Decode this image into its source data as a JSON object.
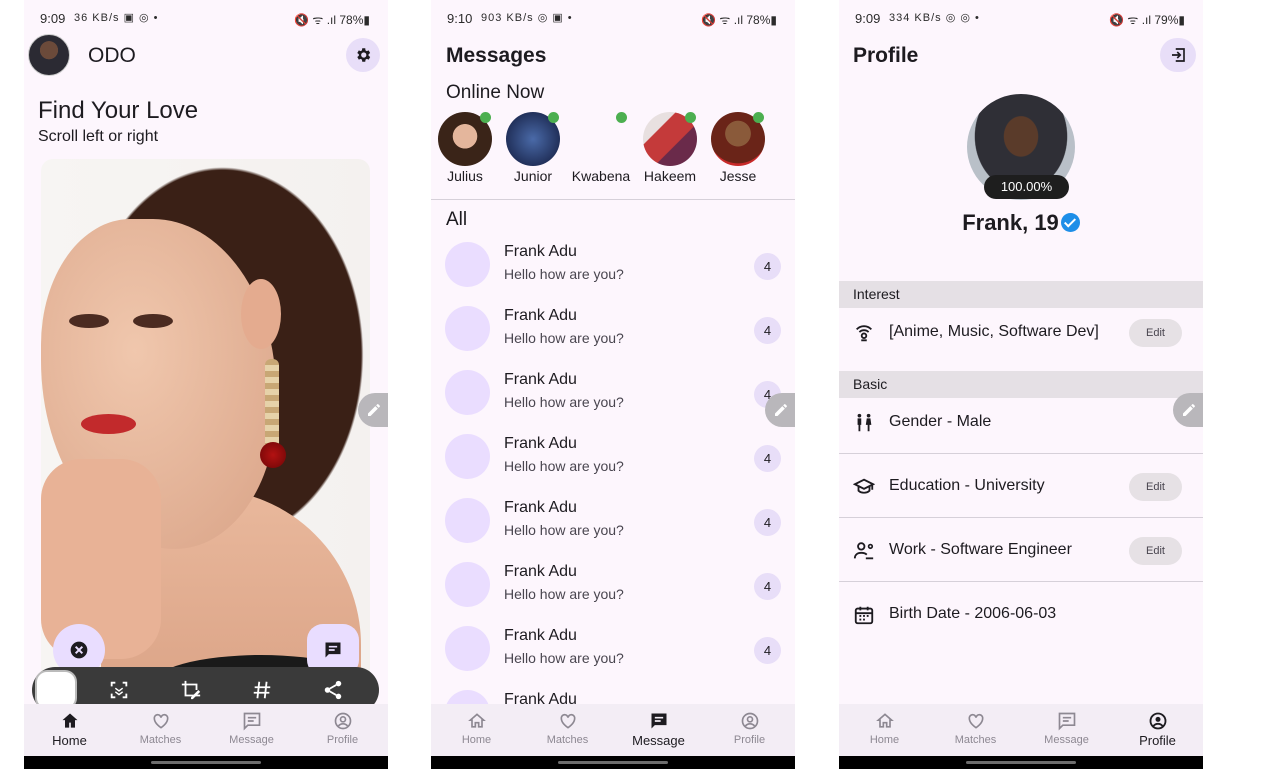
{
  "status_bars": [
    {
      "time": "9:09",
      "extra": "36 KB/s ▣ ◎ •",
      "right": "🔇 ᯤ .ıl 78%▮"
    },
    {
      "time": "9:10",
      "extra": "903 KB/s ◎ ▣ •",
      "right": "🔇 ᯤ .ıl 78%▮"
    },
    {
      "time": "9:09",
      "extra": "334 KB/s ◎ ◎ •",
      "right": "🔇 ᯤ .ıl 79%▮"
    }
  ],
  "home": {
    "app_title": "ODO",
    "heading": "Find Your Love",
    "subheading": "Scroll left or right"
  },
  "messages": {
    "title": "Messages",
    "online_label": "Online Now",
    "all_label": "All",
    "online": [
      {
        "name": "Julius",
        "color": "#c98f78"
      },
      {
        "name": "Junior",
        "color": "#223a6e"
      },
      {
        "name": "Kwabena",
        "color": "#fdf6fd"
      },
      {
        "name": "Hakeem",
        "color": "#c84a4a"
      },
      {
        "name": "Jesse",
        "color": "#8a3a2a"
      }
    ],
    "items": [
      {
        "name": "Frank Adu",
        "text": "Hello how are you?",
        "count": "4"
      },
      {
        "name": "Frank Adu",
        "text": "Hello how are you?",
        "count": "4"
      },
      {
        "name": "Frank Adu",
        "text": "Hello how are you?",
        "count": "4"
      },
      {
        "name": "Frank Adu",
        "text": "Hello how are you?",
        "count": "4"
      },
      {
        "name": "Frank Adu",
        "text": "Hello how are you?",
        "count": "4"
      },
      {
        "name": "Frank Adu",
        "text": "Hello how are you?",
        "count": "4"
      },
      {
        "name": "Frank Adu",
        "text": "Hello how are you?",
        "count": "4"
      },
      {
        "name": "Frank Adu",
        "text": "",
        "count": ""
      }
    ]
  },
  "profile": {
    "title": "Profile",
    "completion": "100.00%",
    "name": "Frank, 19",
    "interest_label": "Interest",
    "interest_value": "[Anime, Music, Software Dev]",
    "basic_label": "Basic",
    "gender": "Gender - Male",
    "education": "Education - University",
    "work": "Work - Software Engineer",
    "birth": "Birth Date - 2006-06-03",
    "edit_label": "Edit"
  },
  "nav": {
    "home": "Home",
    "matches": "Matches",
    "message": "Message",
    "profile": "Profile"
  },
  "colors": {
    "background": "#fdf6fd",
    "accent_container": "#e8def8",
    "online_dot": "#4caf50",
    "verified": "#1d8ee8"
  }
}
